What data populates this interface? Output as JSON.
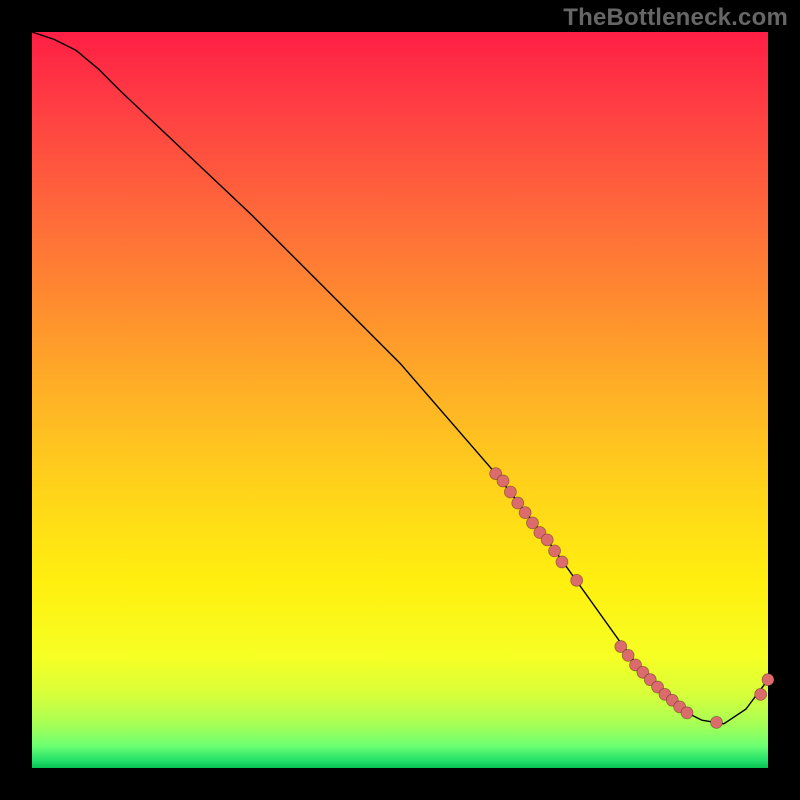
{
  "watermark": {
    "text": "TheBottleneck.com"
  },
  "chart_data": {
    "type": "line",
    "title": "",
    "xlabel": "",
    "ylabel": "",
    "xlim": [
      0,
      100
    ],
    "ylim": [
      0,
      100
    ],
    "grid": false,
    "legend": false,
    "series": [
      {
        "name": "bottleneck-curve",
        "x": [
          0,
          3,
          6,
          9,
          12,
          30,
          50,
          63,
          70,
          75,
          80,
          83,
          86,
          89,
          91,
          94,
          97,
          100
        ],
        "y": [
          100,
          99,
          97.5,
          95,
          92,
          75,
          55,
          40,
          31,
          24,
          17,
          13,
          10,
          7.5,
          6.5,
          6,
          8,
          12
        ]
      }
    ],
    "points": {
      "name": "highlight-points",
      "comment": "coral markers clustered near curve minimum and along descent",
      "x": [
        63,
        64,
        65,
        66,
        67,
        68,
        69,
        70,
        71,
        72,
        74,
        80,
        81,
        82,
        83,
        84,
        85,
        86,
        87,
        88,
        89,
        93,
        99,
        100
      ],
      "y": [
        40,
        39,
        37.5,
        36,
        34.7,
        33.3,
        32,
        31,
        29.5,
        28,
        25.5,
        16.5,
        15.3,
        14,
        13,
        12,
        11,
        10,
        9.2,
        8.3,
        7.5,
        6.2,
        10,
        12
      ]
    },
    "colors": {
      "curve": "#000000",
      "points": "#dc6b6b",
      "gradient_top": "#ff1f45",
      "gradient_bottom": "#06c050"
    }
  }
}
